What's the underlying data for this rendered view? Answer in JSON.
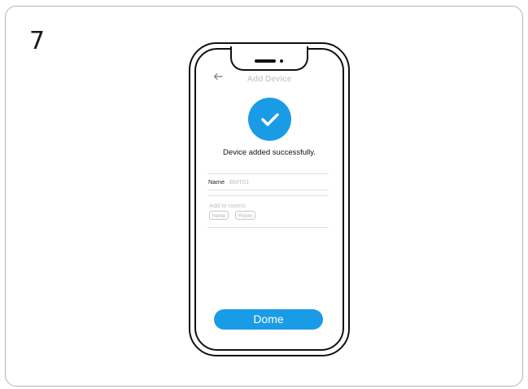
{
  "step": {
    "number": "7"
  },
  "screen": {
    "title": "Add Device",
    "back_icon": "arrow-left-icon",
    "success_icon": "checkmark-icon",
    "success_message": "Device added successfully.",
    "name": {
      "label": "Name",
      "value": "BMT01"
    },
    "rooms": {
      "label": "Add to rooms",
      "options": [
        "home",
        "Room"
      ]
    },
    "done_button": "Dome"
  },
  "colors": {
    "accent": "#1a9be6",
    "border": "#b5b5b5",
    "outline": "#111111",
    "muted_text": "#bdbdbd"
  }
}
